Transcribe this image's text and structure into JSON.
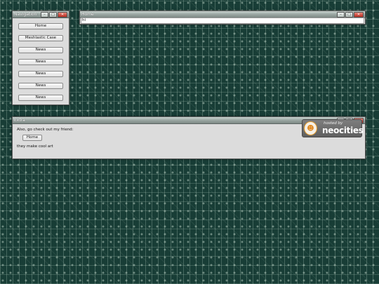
{
  "windows": {
    "navigation": {
      "title": "Navigation",
      "items": [
        "Home",
        "Meshlastic Case",
        "News",
        "News",
        "News",
        "News",
        "News"
      ]
    },
    "home": {
      "title": "Home",
      "address_value": "hi"
    },
    "extra": {
      "title": "Extra",
      "intro_text": "Also, go check out my friend:",
      "friend_link": "Home",
      "note_text": "they make cool art"
    }
  },
  "window_controls": {
    "minimize": "–",
    "maximize": "□",
    "close": "✕"
  },
  "badge": {
    "hosted_text": "hosted by",
    "brand_text": "neocities",
    "icon": "cat-icon"
  },
  "colors": {
    "background": "#183d36",
    "titlebar": "#9aa6a2",
    "window_body": "#dcdcdc",
    "close_button": "#b8281c"
  }
}
